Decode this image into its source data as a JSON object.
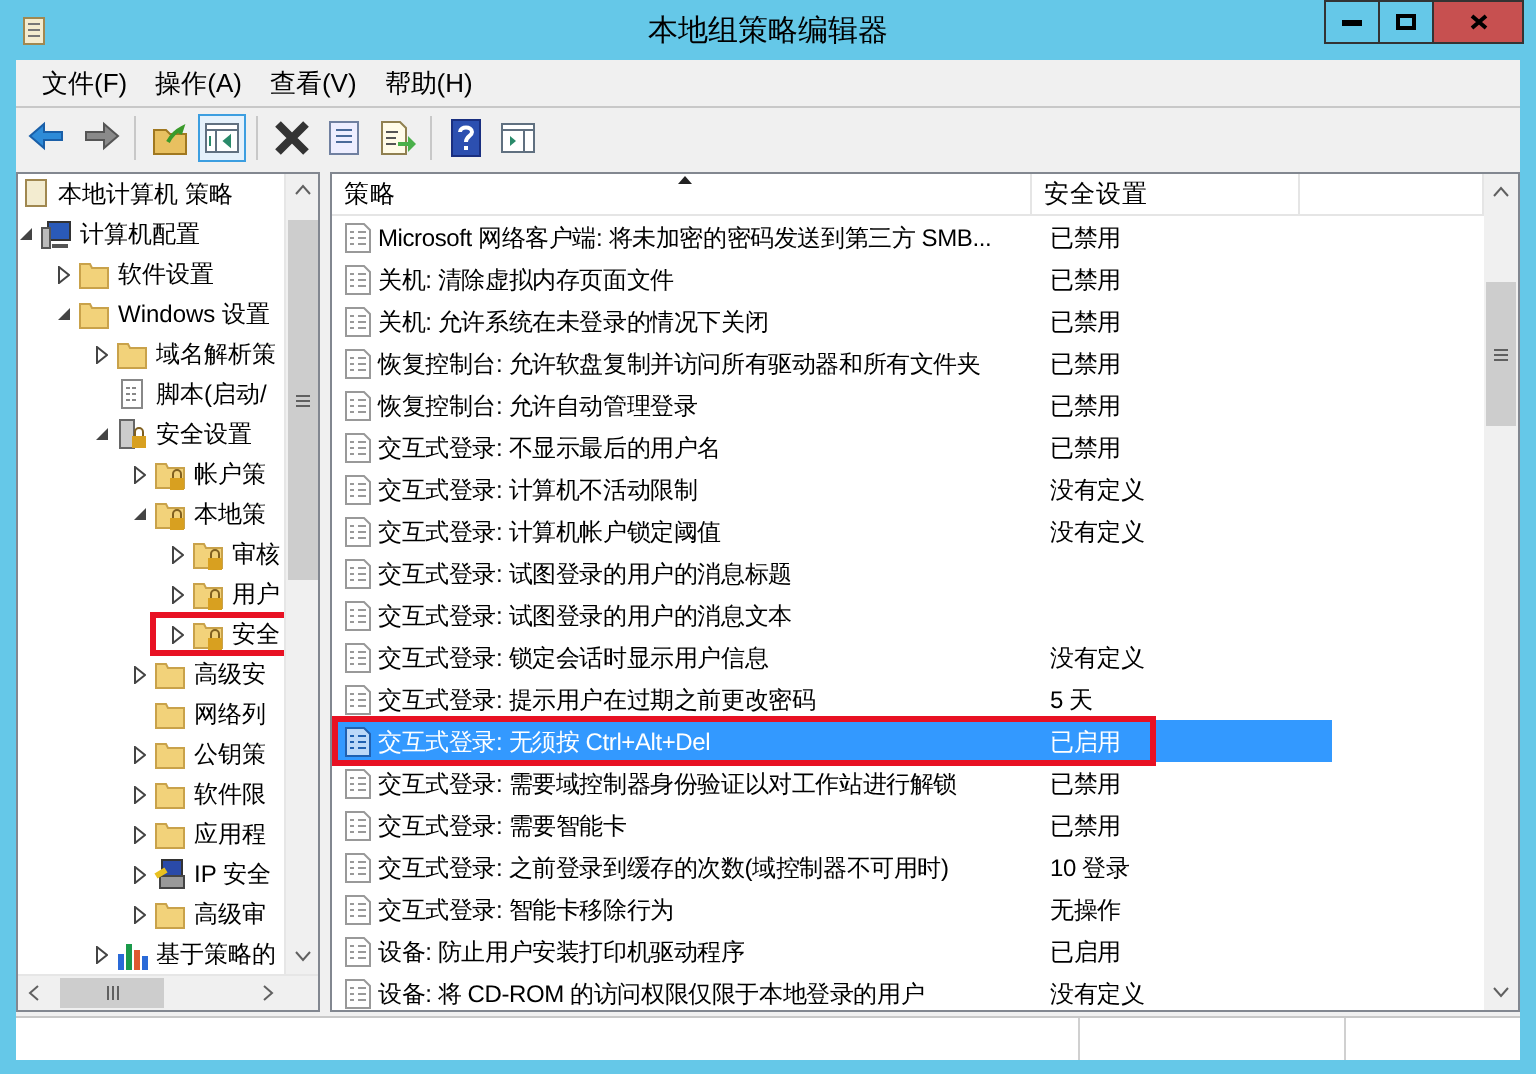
{
  "window": {
    "title": "本地组策略编辑器"
  },
  "menu": [
    "文件(F)",
    "操作(A)",
    "查看(V)",
    "帮助(H)"
  ],
  "toolbar": [
    {
      "kind": "back",
      "selected": false
    },
    {
      "kind": "forward",
      "selected": false
    },
    {
      "kind": "up",
      "selected": false
    },
    {
      "kind": "tree",
      "selected": true
    },
    {
      "kind": "delete",
      "selected": false
    },
    {
      "kind": "properties",
      "selected": false
    },
    {
      "kind": "export",
      "selected": false
    },
    {
      "kind": "help",
      "selected": false
    },
    {
      "kind": "pane",
      "selected": false
    }
  ],
  "tree": [
    {
      "label": "本地计算机 策略",
      "kind": "scroll",
      "marked": false,
      "children": [
        {
          "label": "计算机配置",
          "kind": "computer",
          "expanded": true,
          "marked": false,
          "children": [
            {
              "label": "软件设置",
              "kind": "folder",
              "expanded": false,
              "marked": false
            },
            {
              "label": "Windows 设置",
              "kind": "folder",
              "expanded": true,
              "marked": false,
              "children": [
                {
                  "label": "域名解析策",
                  "kind": "folder",
                  "expanded": false,
                  "marked": false
                },
                {
                  "label": "脚本(启动/",
                  "kind": "script",
                  "marked": false
                },
                {
                  "label": "安全设置",
                  "kind": "server",
                  "expanded": true,
                  "marked": false,
                  "children": [
                    {
                      "label": "帐户策",
                      "kind": "lockfolder",
                      "expanded": false,
                      "marked": false
                    },
                    {
                      "label": "本地策",
                      "kind": "lockfolder",
                      "expanded": true,
                      "marked": false,
                      "children": [
                        {
                          "label": "审核",
                          "kind": "lockfolder",
                          "expanded": false,
                          "marked": false
                        },
                        {
                          "label": "用户",
                          "kind": "lockfolder",
                          "expanded": false,
                          "marked": false
                        },
                        {
                          "label": "安全",
                          "kind": "lockfolder",
                          "expanded": false,
                          "marked": true
                        }
                      ]
                    },
                    {
                      "label": "高级安",
                      "kind": "folder",
                      "expanded": false,
                      "marked": false
                    },
                    {
                      "label": "网络列",
                      "kind": "folder",
                      "marked": false
                    },
                    {
                      "label": "公钥策",
                      "kind": "folder",
                      "expanded": false,
                      "marked": false
                    },
                    {
                      "label": "软件限",
                      "kind": "folder",
                      "expanded": false,
                      "marked": false
                    },
                    {
                      "label": "应用程",
                      "kind": "folder",
                      "expanded": false,
                      "marked": false
                    },
                    {
                      "label": "IP 安全",
                      "kind": "ipsec",
                      "expanded": false,
                      "marked": false
                    },
                    {
                      "label": "高级审",
                      "kind": "folder",
                      "expanded": false,
                      "marked": false
                    }
                  ]
                },
                {
                  "label": "基于策略的",
                  "kind": "chart",
                  "expanded": false,
                  "marked": false
                }
              ]
            }
          ]
        }
      ]
    }
  ],
  "table": {
    "columns": [
      "策略",
      "安全设置"
    ],
    "rows": [
      {
        "policy": "Microsoft 网络客户端: 将未加密的密码发送到第三方 SMB...",
        "setting": "已禁用",
        "selected": false,
        "marked": false
      },
      {
        "policy": "关机: 清除虚拟内存页面文件",
        "setting": "已禁用",
        "selected": false,
        "marked": false
      },
      {
        "policy": "关机: 允许系统在未登录的情况下关闭",
        "setting": "已禁用",
        "selected": false,
        "marked": false
      },
      {
        "policy": "恢复控制台: 允许软盘复制并访问所有驱动器和所有文件夹",
        "setting": "已禁用",
        "selected": false,
        "marked": false
      },
      {
        "policy": "恢复控制台: 允许自动管理登录",
        "setting": "已禁用",
        "selected": false,
        "marked": false
      },
      {
        "policy": "交互式登录: 不显示最后的用户名",
        "setting": "已禁用",
        "selected": false,
        "marked": false
      },
      {
        "policy": "交互式登录: 计算机不活动限制",
        "setting": "没有定义",
        "selected": false,
        "marked": false
      },
      {
        "policy": "交互式登录: 计算机帐户锁定阈值",
        "setting": "没有定义",
        "selected": false,
        "marked": false
      },
      {
        "policy": "交互式登录: 试图登录的用户的消息标题",
        "selected": false,
        "marked": false
      },
      {
        "policy": "交互式登录: 试图登录的用户的消息文本",
        "selected": false,
        "marked": false
      },
      {
        "policy": "交互式登录: 锁定会话时显示用户信息",
        "setting": "没有定义",
        "selected": false,
        "marked": false
      },
      {
        "policy": "交互式登录: 提示用户在过期之前更改密码",
        "setting": "5 天",
        "selected": false,
        "marked": false
      },
      {
        "policy": "交互式登录: 无须按 Ctrl+Alt+Del",
        "setting": "已启用",
        "selected": true,
        "marked": true
      },
      {
        "policy": "交互式登录: 需要域控制器身份验证以对工作站进行解锁",
        "setting": "已禁用",
        "selected": false,
        "marked": false
      },
      {
        "policy": "交互式登录: 需要智能卡",
        "setting": "已禁用",
        "selected": false,
        "marked": false
      },
      {
        "policy": "交互式登录: 之前登录到缓存的次数(域控制器不可用时)",
        "setting": "10 登录",
        "selected": false,
        "marked": false
      },
      {
        "policy": "交互式登录: 智能卡移除行为",
        "setting": "无操作",
        "selected": false,
        "marked": false
      },
      {
        "policy": "设备: 防止用户安装打印机驱动程序",
        "setting": "已启用",
        "selected": false,
        "marked": false
      },
      {
        "policy": "设备: 将 CD-ROM 的访问权限仅限于本地登录的用户",
        "setting": "没有定义",
        "selected": false,
        "marked": false
      }
    ]
  }
}
